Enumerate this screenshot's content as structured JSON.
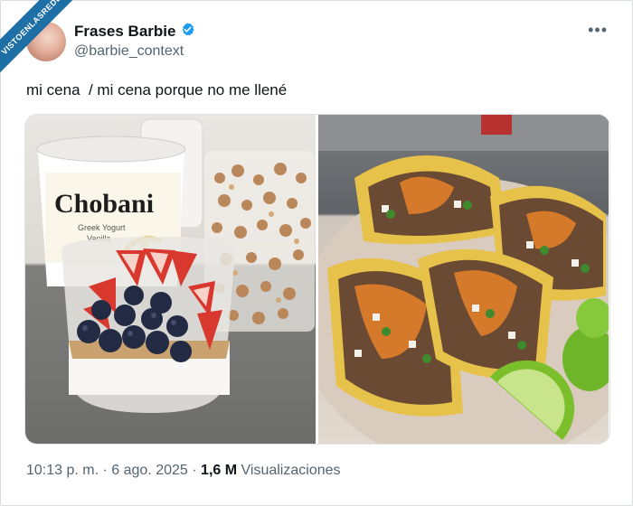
{
  "watermark": "VISTOENLASREDES",
  "author": {
    "name": "Frases Barbie",
    "handle": "@barbie_context",
    "verified": true
  },
  "tweet": {
    "text": "mi cena  / mi cena porque no me llené"
  },
  "media": {
    "left_photo": {
      "brand": "Chobani",
      "product": "Greek Yogurt",
      "flavor": "Vanilla"
    },
    "right_photo": {}
  },
  "meta": {
    "time": "10:13 p. m.",
    "date": "6 ago. 2025",
    "views_count": "1,6 M",
    "views_label": "Visualizaciones",
    "sep": "·"
  },
  "colors": {
    "verified": "#1d9bf0",
    "ribbon": "#1d6fa5",
    "secondary_text": "#536471"
  },
  "icons": {
    "verified": "verified-badge-icon",
    "more": "more-options-icon"
  }
}
